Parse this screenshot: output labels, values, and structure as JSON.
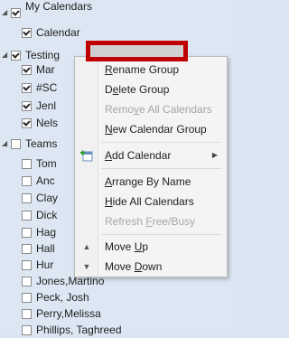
{
  "groups": [
    {
      "label": "My Calendars",
      "checked": true
    },
    {
      "label": "Testing",
      "checked": true
    },
    {
      "label": "Teams",
      "checked": false
    }
  ],
  "my_calendars_items": [
    {
      "label": "Calendar",
      "checked": true
    }
  ],
  "testing_items": [
    {
      "label": "Mar",
      "checked": true
    },
    {
      "label": "#SC",
      "checked": true
    },
    {
      "label": "Jenl",
      "checked": true
    },
    {
      "label": "Nels",
      "checked": true
    }
  ],
  "teams_items": [
    {
      "label": "Tom",
      "checked": false
    },
    {
      "label": "Anc",
      "checked": false
    },
    {
      "label": "Clay",
      "checked": false
    },
    {
      "label": "Dick",
      "checked": false
    },
    {
      "label": "Hag",
      "checked": false
    },
    {
      "label": "Hall",
      "checked": false
    },
    {
      "label": "Hur",
      "checked": false
    },
    {
      "label": "Jones,Martino",
      "checked": false
    },
    {
      "label": "Peck, Josh",
      "checked": false
    },
    {
      "label": "Perry,Melissa",
      "checked": false
    },
    {
      "label": "Phillips, Taghreed",
      "checked": false
    }
  ],
  "context_menu": {
    "items": [
      {
        "label": "Rename Group",
        "underline": "R",
        "rest": "ename Group",
        "disabled": false
      },
      {
        "label": "Delete Group",
        "pre": "D",
        "underline": "e",
        "rest": "lete Group",
        "disabled": false
      },
      {
        "label": "Remove All Calendars",
        "pre": "Remo",
        "underline": "v",
        "rest": "e All Calendars",
        "disabled": true
      },
      {
        "label": "New Calendar Group",
        "underline": "N",
        "rest": "ew Calendar Group",
        "disabled": false
      },
      {
        "label": "Add Calendar",
        "underline": "A",
        "rest": "dd Calendar",
        "disabled": false,
        "icon": "add-calendar-icon",
        "submenu": true
      },
      {
        "label": "Arrange By Name",
        "underline": "A",
        "rest": "rrange By Name",
        "disabled": false
      },
      {
        "label": "Hide All Calendars",
        "underline": "H",
        "rest": "ide All Calendars",
        "disabled": false
      },
      {
        "label": "Refresh Free/Busy",
        "pre": "Refresh ",
        "underline": "F",
        "rest": "ree/Busy",
        "disabled": true
      },
      {
        "label": "Move Up",
        "pre": "Move ",
        "underline": "U",
        "rest": "p",
        "disabled": false,
        "icon": "move-up-icon"
      },
      {
        "label": "Move Down",
        "pre": "Move ",
        "underline": "D",
        "rest": "own",
        "disabled": false,
        "icon": "move-down-icon"
      }
    ]
  },
  "colors": {
    "pane_bg": "#dde7f3",
    "highlight_border": "#c00000",
    "disabled_text": "#a6a6a6"
  }
}
